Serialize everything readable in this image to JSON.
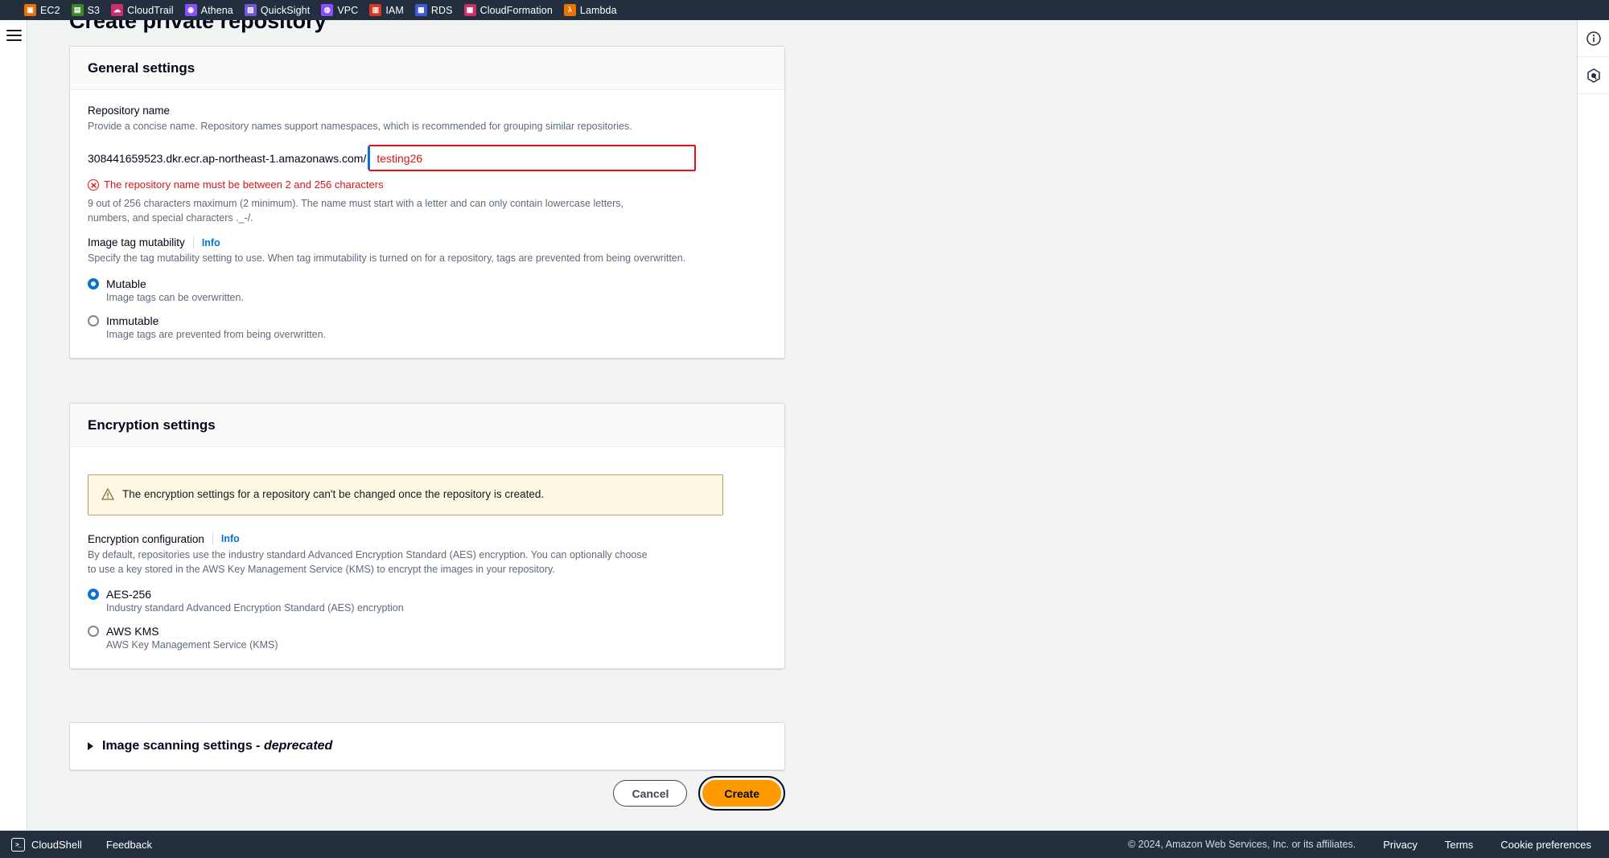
{
  "topnav": {
    "services": [
      {
        "label": "EC2",
        "icon": "ec2-icon",
        "color": "#ed7100",
        "glyph": "▣"
      },
      {
        "label": "S3",
        "icon": "s3-icon",
        "color": "#3f8624",
        "glyph": "▤"
      },
      {
        "label": "CloudTrail",
        "icon": "cloudtrail-icon",
        "color": "#cf2d6b",
        "glyph": "☁"
      },
      {
        "label": "Athena",
        "icon": "athena-icon",
        "color": "#8c4fff",
        "glyph": "◉"
      },
      {
        "label": "QuickSight",
        "icon": "quicksight-icon",
        "color": "#7157d9",
        "glyph": "▨"
      },
      {
        "label": "VPC",
        "icon": "vpc-icon",
        "color": "#8c4fff",
        "glyph": "◍"
      },
      {
        "label": "IAM",
        "icon": "iam-icon",
        "color": "#dd3522",
        "glyph": "▥"
      },
      {
        "label": "RDS",
        "icon": "rds-icon",
        "color": "#3b5bdb",
        "glyph": "▩"
      },
      {
        "label": "CloudFormation",
        "icon": "cloudformation-icon",
        "color": "#cf2d6b",
        "glyph": "▦"
      },
      {
        "label": "Lambda",
        "icon": "lambda-icon",
        "color": "#ed7100",
        "glyph": "λ"
      }
    ]
  },
  "page": {
    "title": "Create private repository"
  },
  "general_settings": {
    "title": "General settings",
    "repo_name_label": "Repository name",
    "repo_name_desc": "Provide a concise name. Repository names support namespaces, which is recommended for grouping similar repositories.",
    "registry_prefix": "308441659523.dkr.ecr.ap-northeast-1.amazonaws.com/",
    "repo_name_value": "testing26",
    "repo_name_placeholder": "",
    "error_text": "The repository name must be between 2 and 256 characters",
    "constraint_text": "9 out of 256 characters maximum (2 minimum). The name must start with a letter and can only contain lowercase letters, numbers, and special characters ._-/.",
    "mutability_label": "Image tag mutability",
    "mutability_info": "Info",
    "mutability_desc": "Specify the tag mutability setting to use. When tag immutability is turned on for a repository, tags are prevented from being overwritten.",
    "options": [
      {
        "label": "Mutable",
        "desc": "Image tags can be overwritten.",
        "selected": true
      },
      {
        "label": "Immutable",
        "desc": "Image tags are prevented from being overwritten.",
        "selected": false
      }
    ]
  },
  "encryption_settings": {
    "title": "Encryption settings",
    "alert_text": "The encryption settings for a repository can't be changed once the repository is created.",
    "config_label": "Encryption configuration",
    "config_info": "Info",
    "config_desc": "By default, repositories use the industry standard Advanced Encryption Standard (AES) encryption. You can optionally choose to use a key stored in the AWS Key Management Service (KMS) to encrypt the images in your repository.",
    "options": [
      {
        "label": "AES-256",
        "desc": "Industry standard Advanced Encryption Standard (AES) encryption",
        "selected": true
      },
      {
        "label": "AWS KMS",
        "desc": "AWS Key Management Service (KMS)",
        "selected": false
      }
    ]
  },
  "scanning_settings": {
    "title": "Image scanning settings",
    "suffix_dash": "-",
    "suffix": "deprecated"
  },
  "actions": {
    "cancel_label": "Cancel",
    "create_label": "Create"
  },
  "footer": {
    "cloudshell_label": "CloudShell",
    "cloudshell_glyph": ">_",
    "feedback_label": "Feedback",
    "copyright": "© 2024, Amazon Web Services, Inc. or its affiliates.",
    "links": [
      "Privacy",
      "Terms",
      "Cookie preferences"
    ]
  },
  "colors": {
    "nav_bg": "#232f3e",
    "accent_blue": "#0972d3",
    "error_red": "#d91515",
    "create_orange": "#ff9900",
    "alert_bg": "#fcf8e3"
  }
}
